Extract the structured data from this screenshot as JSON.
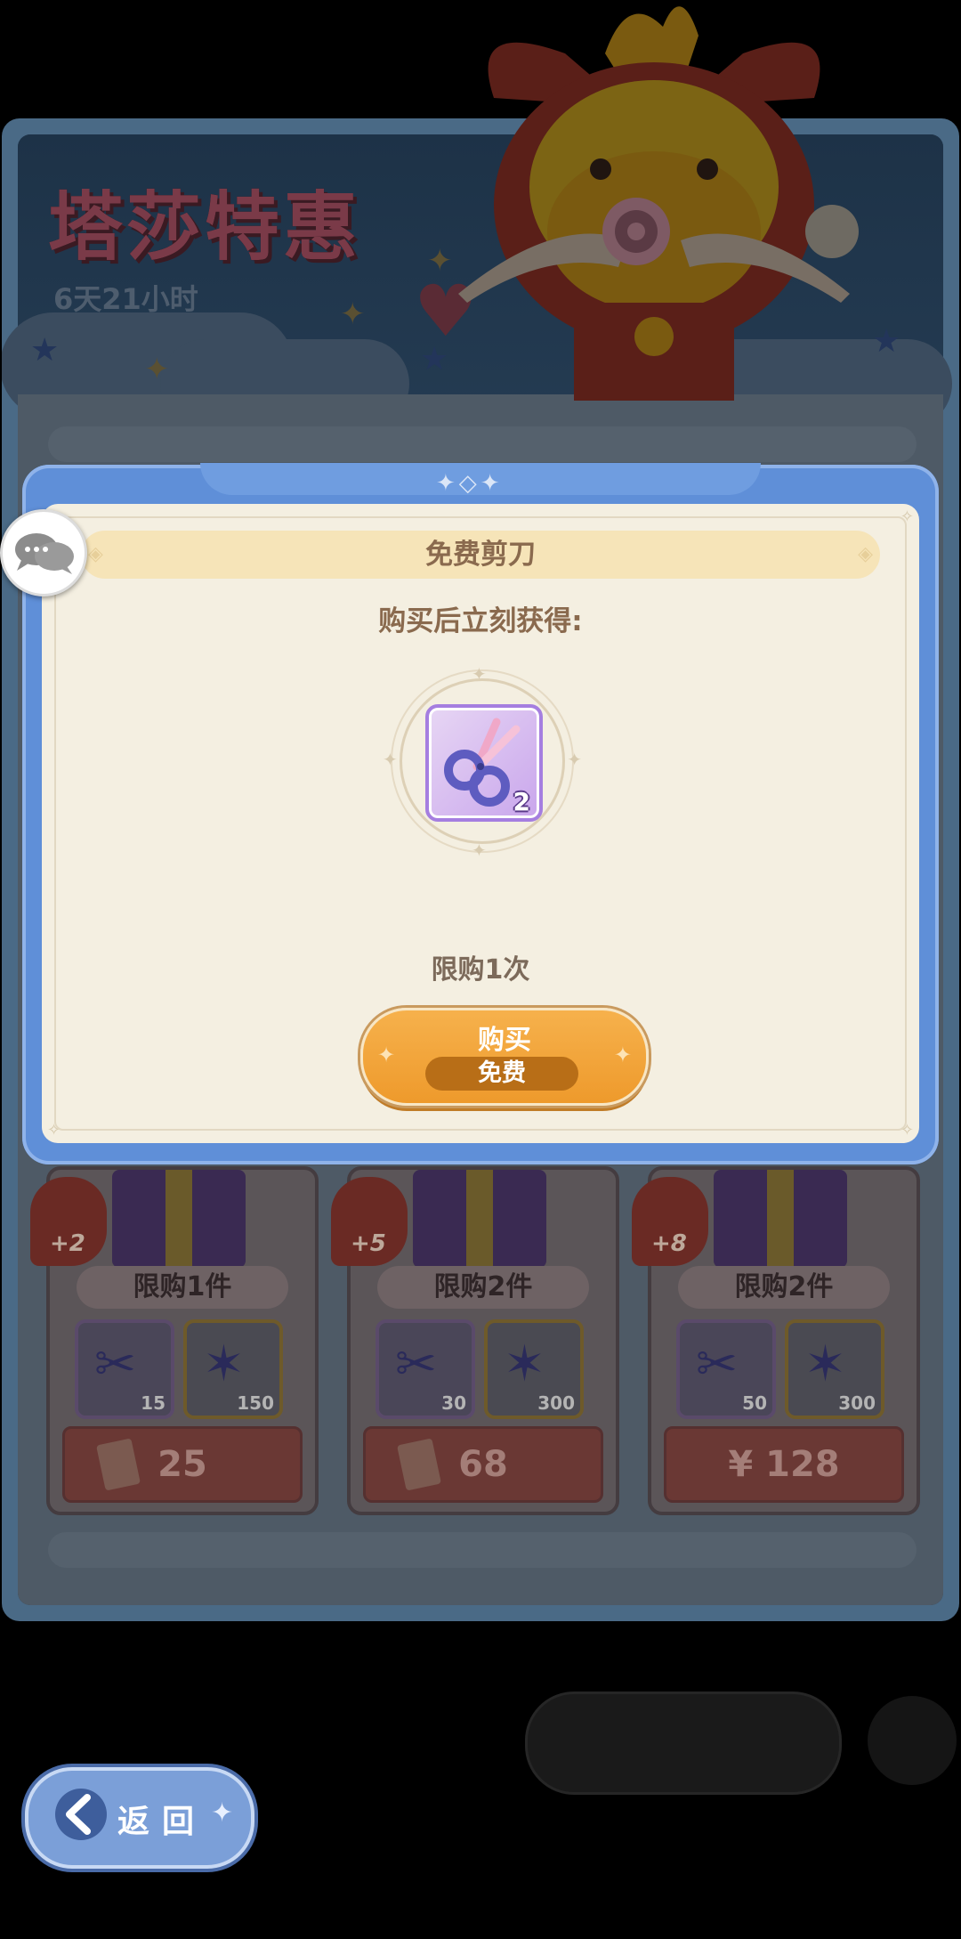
{
  "background_shop": {
    "title": "塔莎特惠",
    "timer": "6天21小时",
    "cards": [
      {
        "bonus": "+2",
        "limit": "限购1件",
        "items": [
          {
            "icon": "scissors-icon",
            "count": "15"
          },
          {
            "icon": "star-crystal-icon",
            "count": "150"
          }
        ],
        "price": "25",
        "price_icon": "ticket-icon"
      },
      {
        "bonus": "+5",
        "limit": "限购2件",
        "items": [
          {
            "icon": "scissors-icon",
            "count": "30"
          },
          {
            "icon": "star-crystal-icon",
            "count": "300"
          }
        ],
        "price": "68",
        "price_icon": "ticket-icon"
      },
      {
        "bonus": "+8",
        "limit": "限购2件",
        "items": [
          {
            "icon": "scissors-icon",
            "count": "50"
          },
          {
            "icon": "star-crystal-icon",
            "count": "300"
          }
        ],
        "price": "¥ 128",
        "price_icon": ""
      }
    ]
  },
  "dialog": {
    "title": "免费剪刀",
    "subtitle": "购买后立刻获得:",
    "reward": {
      "icon": "scissors-icon",
      "count": "2"
    },
    "limit": "限购1次",
    "buy_label": "购买",
    "buy_price": "免费"
  },
  "back_button": {
    "label": "返回"
  },
  "colors": {
    "modal_border": "#5f8fd8",
    "modal_body": "#f4efe1",
    "header_bar": "#f6e4b8",
    "buy_button": "#f0a236",
    "price_pill": "#b86e17",
    "text_brown": "#8a6a4e"
  }
}
